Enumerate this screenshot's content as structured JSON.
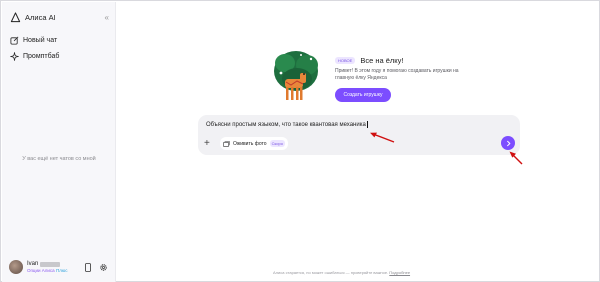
{
  "app": {
    "title": "Алиса AI",
    "colors": {
      "accent": "#7c4dff",
      "sidebar_bg": "#f7f7fa",
      "composer_bg": "#f1f1f4",
      "arrow": "#d01010"
    }
  },
  "sidebar": {
    "collapse_icon": "double-chevron-left-icon",
    "items": [
      {
        "label": "Новый чат",
        "icon": "compose-icon"
      },
      {
        "label": "Промптбаб",
        "icon": "sparkle-icon"
      }
    ],
    "empty_text": "У вас ещё нет чатов со мной",
    "user": {
      "name": "Ivan",
      "plan_prefix": "Опции Алиса",
      "plan_suffix": "Плюс"
    }
  },
  "promo": {
    "badge": "НОВОЕ",
    "title": "Все на ёлку!",
    "text": "Привет! В этом году я помогаю создавать игрушки на главную ёлку Яндекса",
    "button": "Создать игрушку"
  },
  "composer": {
    "input_value": "Объясни простым языком, что такое квантовая механика",
    "photo_label": "Оживить фото",
    "photo_tag": "Скоро"
  },
  "footer": {
    "text": "Алиса старается, но может ошибаться — проверяйте важное.",
    "link": "Подробнее"
  }
}
